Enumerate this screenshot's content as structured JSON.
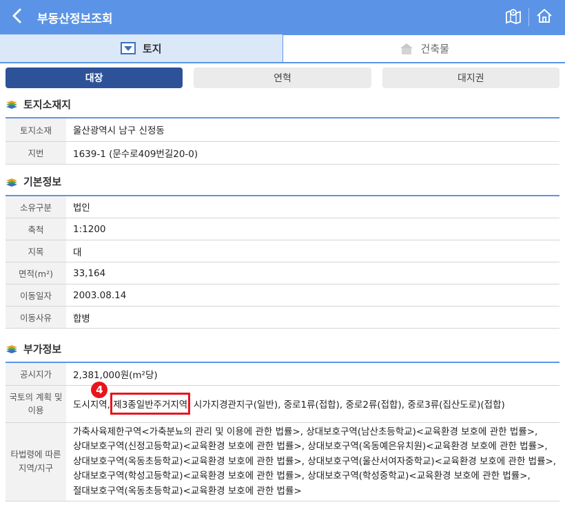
{
  "header": {
    "title": "부동산정보조회",
    "back_icon": "chevron-left-icon",
    "map_icon": "map-icon",
    "home_icon": "home-icon"
  },
  "tabs": [
    {
      "label": "토지",
      "icon": "land-icon",
      "active": true
    },
    {
      "label": "건축물",
      "icon": "building-icon",
      "active": false
    }
  ],
  "subtabs": [
    {
      "label": "대장",
      "active": true
    },
    {
      "label": "연혁",
      "active": false
    },
    {
      "label": "대지권",
      "active": false
    }
  ],
  "sections": {
    "location": {
      "title": "토지소재지",
      "rows": [
        {
          "label": "토지소재",
          "value": "울산광역시 남구 신정동"
        },
        {
          "label": "지번",
          "value": "1639-1 (문수로409번길20-0)"
        }
      ]
    },
    "basic": {
      "title": "기본정보",
      "rows": [
        {
          "label": "소유구분",
          "value": "법인"
        },
        {
          "label": "축척",
          "value": "1:1200"
        },
        {
          "label": "지목",
          "value": "대"
        },
        {
          "label": "면적(m²)",
          "value": "33,164"
        },
        {
          "label": "이동일자",
          "value": "2003.08.14"
        },
        {
          "label": "이동사유",
          "value": "합병"
        }
      ]
    },
    "extra": {
      "title": "부가정보",
      "price_label": "공시지가",
      "price_value": "2,381,000원(m²당)",
      "plan_label": "국토의 계획 및 이용",
      "plan_value_pre": "도시지역,",
      "plan_value_hl": "제3종일반주거지역",
      "plan_value_post": ", 시가지경관지구(일반), 중로1류(접합), 중로2류(접합), 중로3류(집산도로)(접합)",
      "other_label": "타법령에 따른 지역/지구",
      "other_lines": [
        "가축사육제한구역<가축분뇨의 관리 및 이용에 관한 법률>, 상대보호구역(남산초등학교)<교육환경 보호에 관한 법률>,",
        "상대보호구역(신정고등학교)<교육환경 보호에 관한 법률>, 상대보호구역(옥동예은유치원)<교육환경 보호에 관한 법률>,",
        "상대보호구역(옥동초등학교)<교육환경 보호에 관한 법률>, 상대보호구역(울산서여자중학교)<교육환경 보호에 관한 법률>,",
        "상대보호구역(학성고등학교)<교육환경 보호에 관한 법률>, 상대보호구역(학성중학교)<교육환경 보호에 관한 법률>,",
        "절대보호구역(옥동초등학교)<교육환경 보호에 관한 법률>"
      ]
    }
  },
  "annotation": {
    "badge": "4",
    "color": "#e8141c"
  },
  "colors": {
    "header_bg": "#5b94e6",
    "active_subtab": "#2d5298"
  }
}
